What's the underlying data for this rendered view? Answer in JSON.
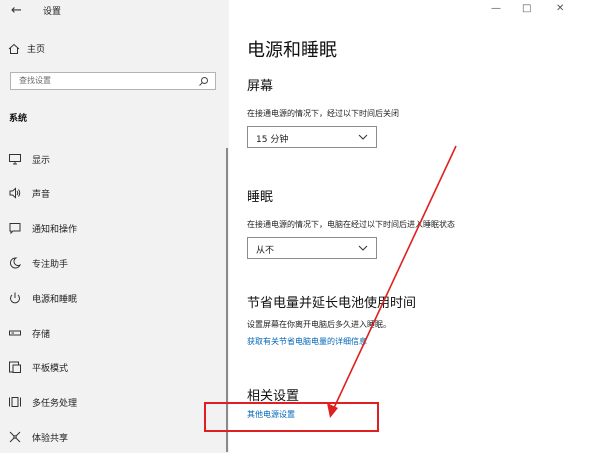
{
  "header": {
    "app_title": "设置",
    "back_glyph": "←",
    "minimize_glyph": "—",
    "maximize_glyph": "□",
    "close_glyph": "✕"
  },
  "sidebar": {
    "home_label": "主页",
    "search": {
      "placeholder": "查找设置"
    },
    "section_title": "系统",
    "items": [
      {
        "label": "显示",
        "icon": "monitor-icon"
      },
      {
        "label": "声音",
        "icon": "speaker-icon"
      },
      {
        "label": "通知和操作",
        "icon": "notification-icon"
      },
      {
        "label": "专注助手",
        "icon": "moon-icon"
      },
      {
        "label": "电源和睡眠",
        "icon": "power-icon",
        "selected": true
      },
      {
        "label": "存储",
        "icon": "storage-icon"
      },
      {
        "label": "平板模式",
        "icon": "tablet-icon"
      },
      {
        "label": "多任务处理",
        "icon": "multitask-icon"
      },
      {
        "label": "体验共享",
        "icon": "share-icon"
      }
    ]
  },
  "main": {
    "title": "电源和睡眠",
    "screen": {
      "heading": "屏幕",
      "desc": "在接通电源的情况下，经过以下时间后关闭",
      "value": "15 分钟"
    },
    "sleep": {
      "heading": "睡眠",
      "desc": "在接通电源的情况下，电脑在经过以下时间后进入睡眠状态",
      "value": "从不"
    },
    "battery": {
      "heading": "节省电量并延长电池使用时间",
      "desc": "设置屏幕在你离开电脑后多久进入睡眠。",
      "link": "获取有关节省电脑电量的详细信息"
    },
    "related": {
      "heading": "相关设置",
      "link": "其他电源设置"
    }
  },
  "colors": {
    "accent": "#0067b8",
    "annotation": "#e02020",
    "sidebar_bg": "#f2f2f2"
  }
}
